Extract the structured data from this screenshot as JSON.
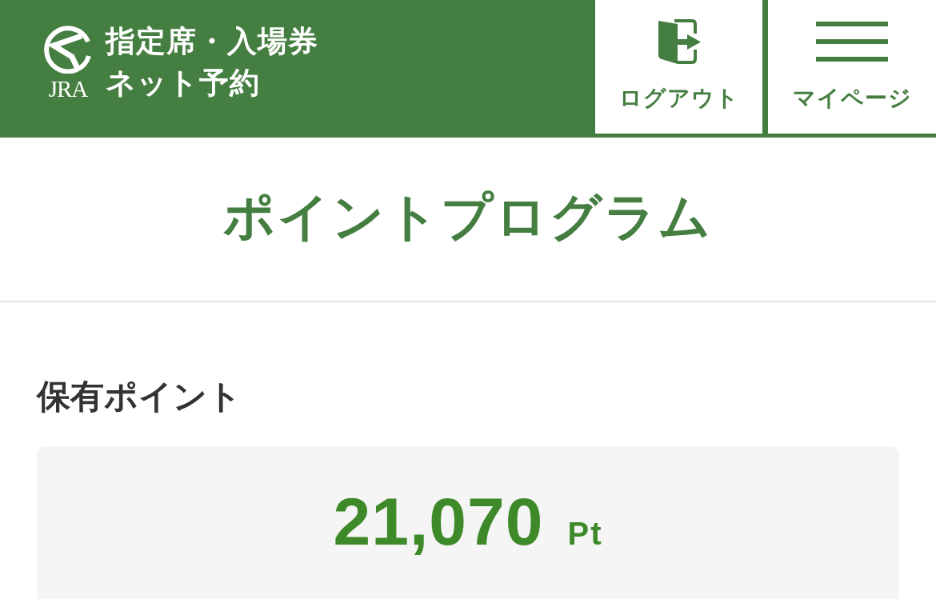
{
  "header": {
    "logo_text": "JRA",
    "title_lines": [
      "指定席・入場券",
      "ネット予約"
    ],
    "buttons": [
      {
        "kind": "logout",
        "label": "ログアウト"
      },
      {
        "kind": "menu",
        "label": "マイページ"
      }
    ]
  },
  "page_title": "ポイントプログラム",
  "points_section": {
    "heading": "保有ポイント",
    "value": "21,070",
    "unit": "Pt"
  }
}
